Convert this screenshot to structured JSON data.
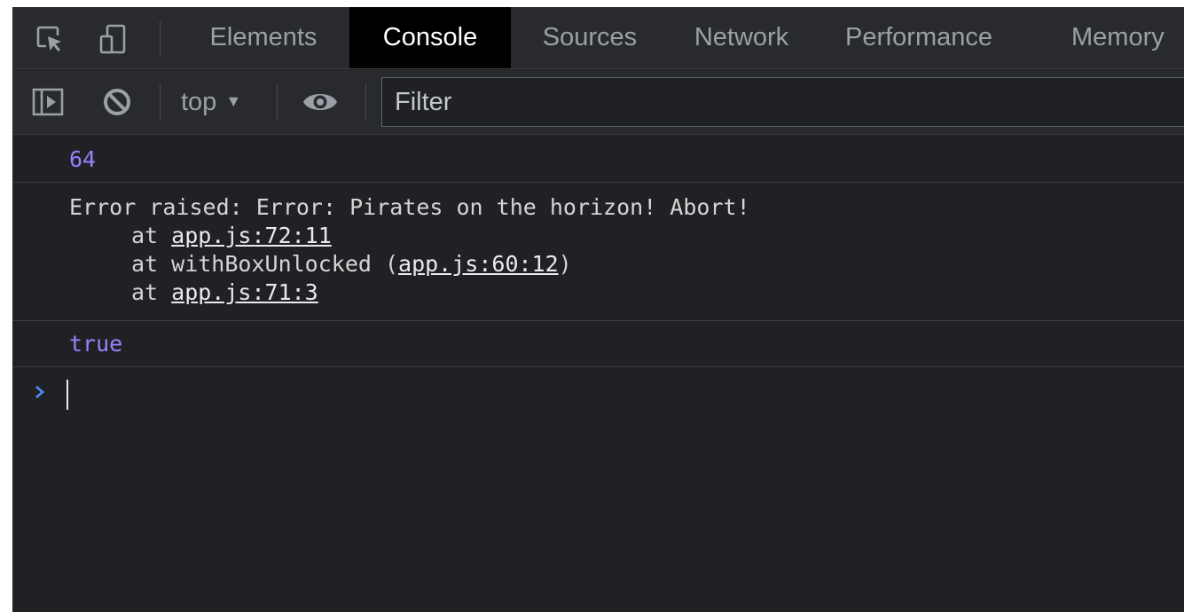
{
  "tabbar": {
    "tabs": [
      {
        "label": "Elements",
        "active": false
      },
      {
        "label": "Console",
        "active": true
      },
      {
        "label": "Sources",
        "active": false
      },
      {
        "label": "Network",
        "active": false
      },
      {
        "label": "Performance",
        "active": false
      },
      {
        "label": "Memory",
        "active": false
      }
    ],
    "icons": [
      "inspect-element-icon",
      "device-toolbar-icon"
    ]
  },
  "toolbar": {
    "context": "top",
    "icons": [
      "show-sidebar-icon",
      "clear-console-icon",
      "live-expression-eye-icon"
    ],
    "filter_placeholder": "Filter"
  },
  "console": {
    "messages": [
      {
        "type": "number",
        "text": "64"
      },
      {
        "type": "error",
        "message": "Error raised: Error: Pirates on the horizon! Abort!",
        "stack": [
          {
            "prefix": "at ",
            "func": "",
            "location": "app.js:72:11"
          },
          {
            "prefix": "at ",
            "func": "withBoxUnlocked (",
            "location": "app.js:60:12",
            "suffix": ")"
          },
          {
            "prefix": "at ",
            "func": "",
            "location": "app.js:71:3"
          }
        ]
      },
      {
        "type": "boolean",
        "text": "true"
      }
    ],
    "prompt_symbol": ">"
  },
  "colors": {
    "background": "#202124",
    "toolbar": "#292a2d",
    "active_tab": "#000000",
    "value_purple": "#9980ff",
    "prompt_blue": "#4d90fe"
  }
}
